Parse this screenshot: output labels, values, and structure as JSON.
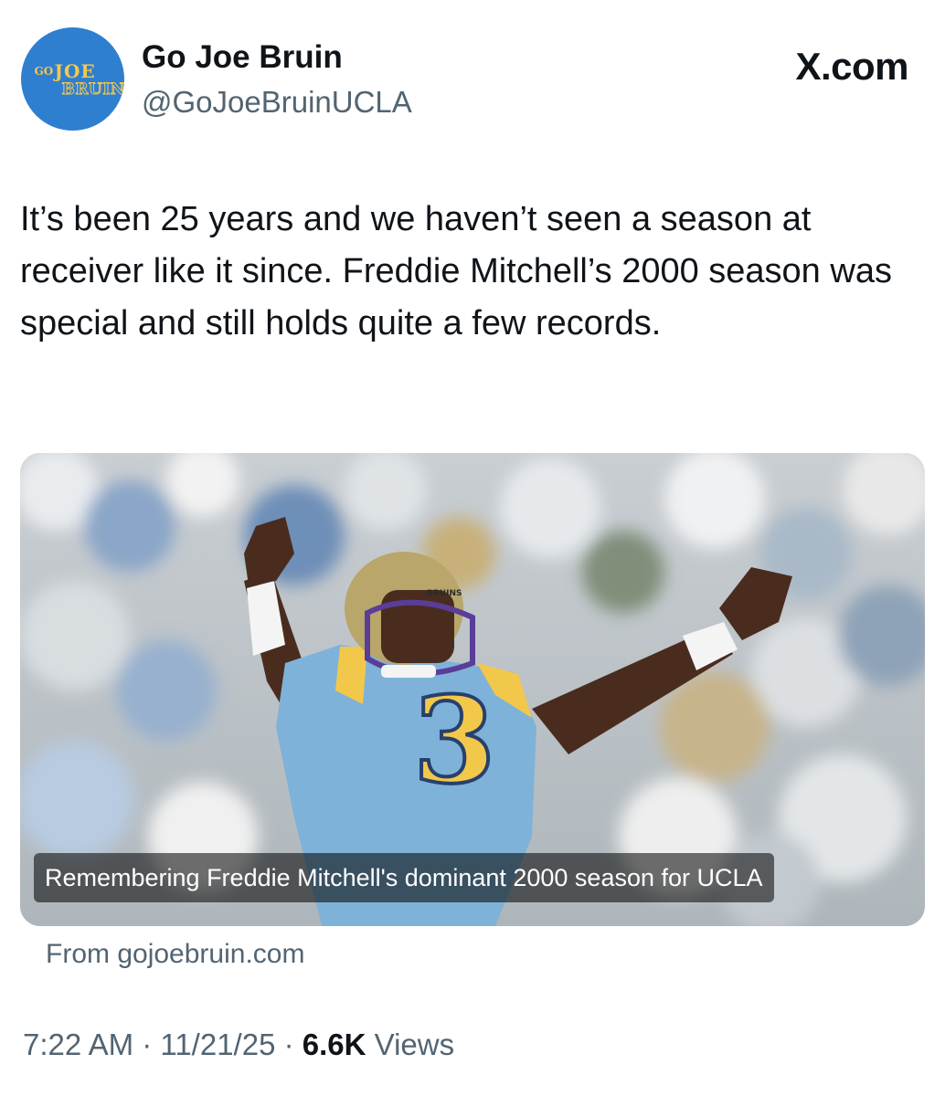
{
  "author": {
    "name": "Go Joe Bruin",
    "handle": "@GoJoeBruinUCLA",
    "avatar_icon": "go-joe-bruin-logo",
    "avatar_logo_text": [
      "GO",
      "JOE",
      "BRUIN"
    ],
    "avatar_color": "#2f7fd0"
  },
  "source": "X.com",
  "tweet": {
    "text": "It’s been 25 years and we haven’t seen a season at receiver like it since. Freddie Mitchell’s 2000 season was special and still holds quite a few records."
  },
  "card": {
    "image_jersey_number": "3",
    "image_helmet_text": "BRUINS",
    "caption": "Remembering Freddie Mitchell's dominant 2000 season for UCLA",
    "from": "From gojoebruin.com"
  },
  "meta": {
    "time": "7:22 AM",
    "date": "11/21/25",
    "separator": "·",
    "views_count": "6.6K",
    "views_label": "Views"
  },
  "colors": {
    "text": "#0f1419",
    "secondary": "#536471",
    "ucla_blue": "#7fb2d8",
    "ucla_gold": "#f2c84b"
  }
}
